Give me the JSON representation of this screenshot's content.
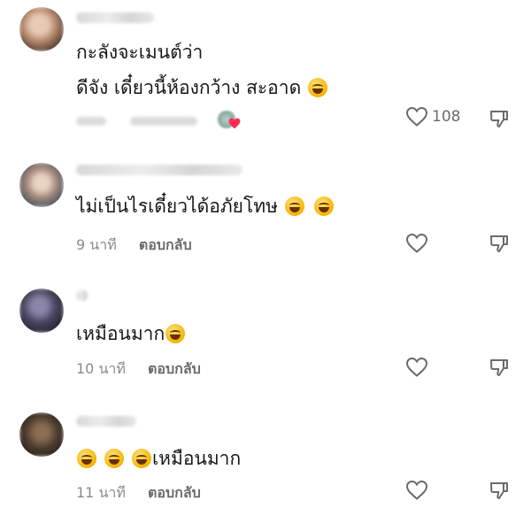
{
  "comments": [
    {
      "lines": [
        "กะลังจะเมนต์ว่า",
        "ดีจัง เดี๋ยวนี้ห้องกว้าง สะอาด"
      ],
      "like_count": "108",
      "time": "",
      "reply_label": ""
    },
    {
      "lines": [
        "ไม่เป็นไรเดี๋ยวได้อภัยโทษ"
      ],
      "like_count": "",
      "time": "9 นาที",
      "reply_label": "ตอบกลับ"
    },
    {
      "lines": [
        "เหมือนมาก"
      ],
      "like_count": "",
      "time": "10 นาที",
      "reply_label": "ตอบกลับ"
    },
    {
      "lines": [
        "เหมือนมาก"
      ],
      "like_count": "",
      "time": "11 นาที",
      "reply_label": "ตอบกลับ"
    }
  ],
  "icons": {
    "like": "heart-outline-icon",
    "dislike": "thumbs-down-icon",
    "emoji": "laughing-emoji-icon"
  },
  "colors": {
    "text": "#161616",
    "meta": "#8a8a8a",
    "icon": "#6b6b6b"
  }
}
